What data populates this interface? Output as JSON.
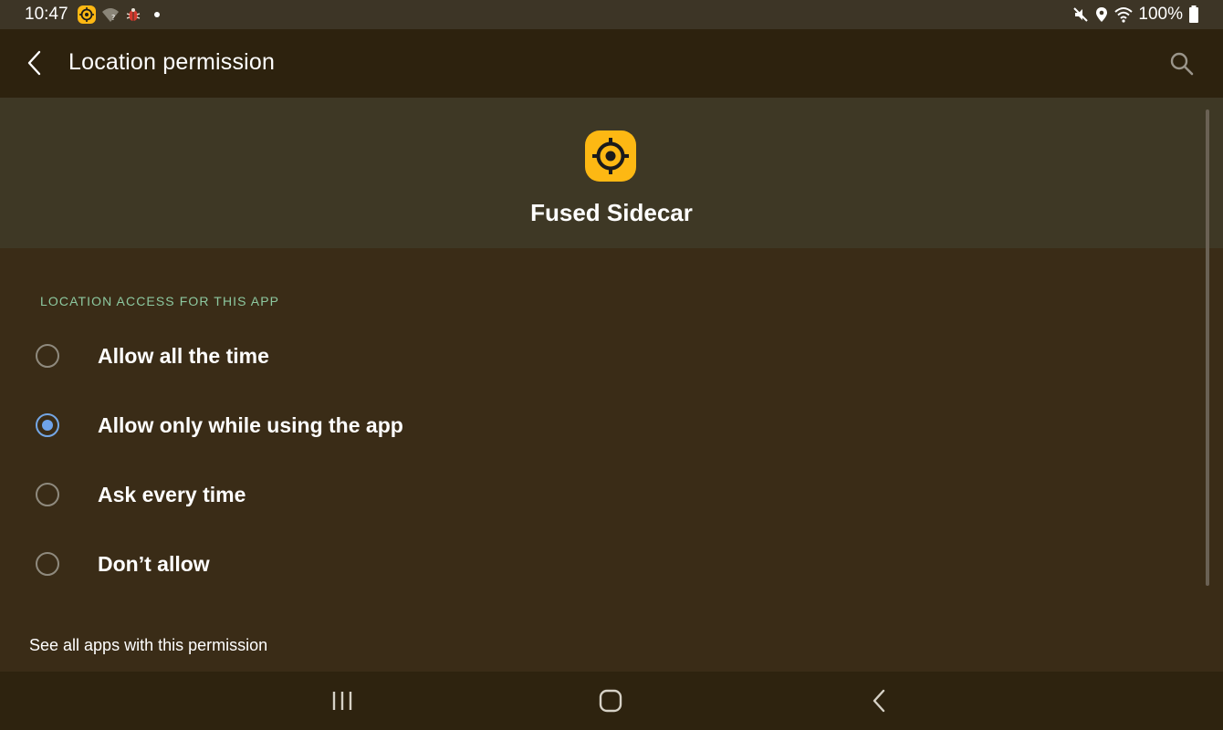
{
  "status_bar": {
    "time": "10:47",
    "battery": "100%",
    "left_icons": [
      "fused-sidecar-notification-icon",
      "wifi-question-icon",
      "bug-icon",
      "more-notifications-dot"
    ],
    "right_icons": [
      "mute-icon",
      "location-pin-icon",
      "wifi-icon",
      "battery-icon"
    ]
  },
  "app_bar": {
    "title": "Location permission",
    "back_icon": "chevron-left-icon",
    "search_icon": "search-icon"
  },
  "app_header": {
    "app_name": "Fused Sidecar",
    "app_icon": "crosshair-icon",
    "icon_color": "#fdb813"
  },
  "section_header": "LOCATION ACCESS FOR THIS APP",
  "options": [
    {
      "label": "Allow all the time",
      "selected": false
    },
    {
      "label": "Allow only while using the app",
      "selected": true
    },
    {
      "label": "Ask every time",
      "selected": false
    },
    {
      "label": "Don’t allow",
      "selected": false
    }
  ],
  "see_all_link": "See all apps with this permission",
  "nav_bar": {
    "buttons": [
      "recent-apps-icon",
      "home-icon",
      "back-icon"
    ]
  },
  "colors": {
    "background": "#3a2c17",
    "app_bar": "#2d220e",
    "header_panel": "#3e3825",
    "accent_radio": "#6fa3ea",
    "section_header": "#8dc9a0"
  }
}
